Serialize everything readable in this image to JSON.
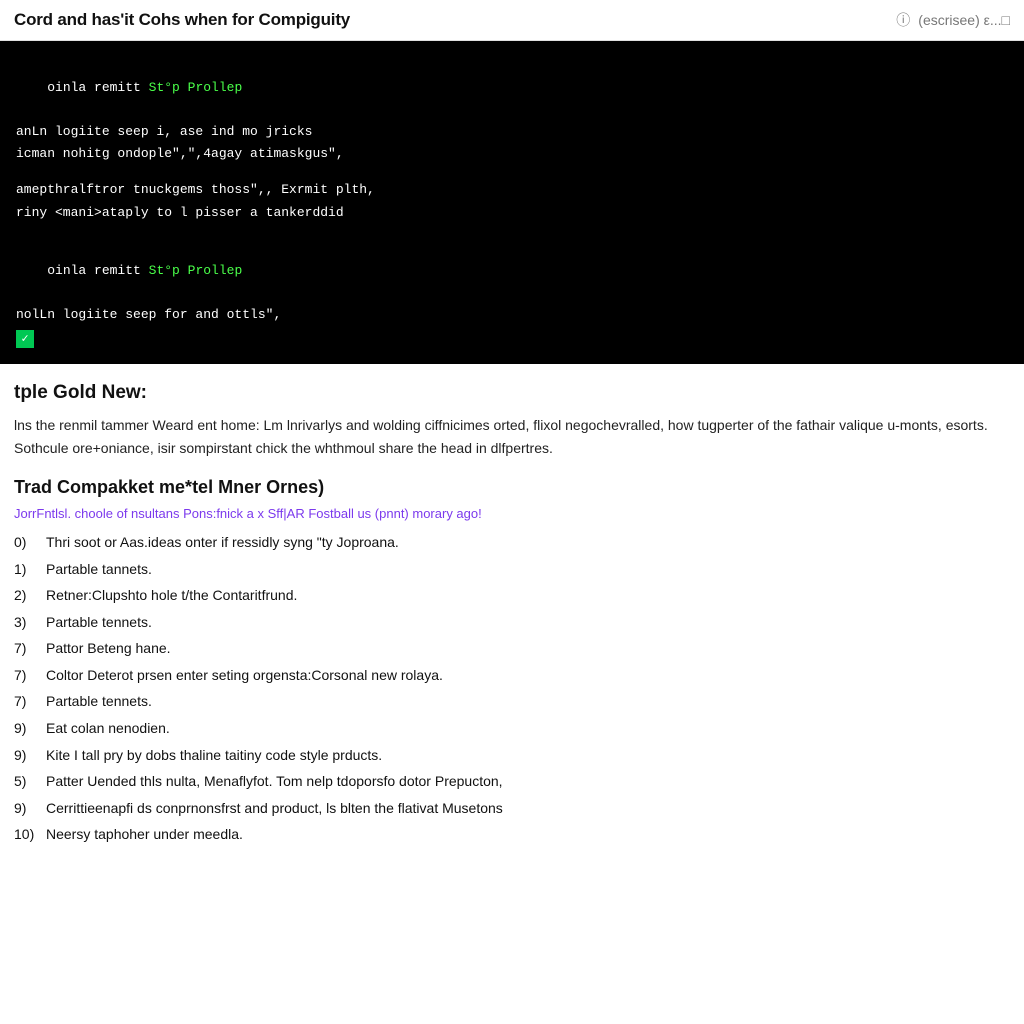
{
  "header": {
    "title": "Cord and has'it Cohs when for Compiguity",
    "icon_info": "ⓘ",
    "meta_text": "(escrisee) ε...□"
  },
  "code_block": {
    "lines": [
      {
        "type": "mixed",
        "parts": [
          {
            "text": "oinla remitt ",
            "color": "white"
          },
          {
            "text": "St°p Prollep",
            "color": "green"
          }
        ]
      },
      {
        "type": "white",
        "text": "anLn logiite seep i, ase ind mo jricks"
      },
      {
        "type": "white",
        "text": "icman nohitg ondople\",\",4agay atimaskgus\","
      },
      {
        "type": "blank"
      },
      {
        "type": "white",
        "text": "amepthralftror tnuckgems thoss\",, Exrmit plth,"
      },
      {
        "type": "white",
        "text": "riny <mani>ataply to l pisser a tankerddid"
      },
      {
        "type": "blank"
      },
      {
        "type": "mixed",
        "parts": [
          {
            "text": "oinla remitt ",
            "color": "white"
          },
          {
            "text": "St°p Prollep",
            "color": "green"
          }
        ]
      },
      {
        "type": "white",
        "text": "nolLn logiite seep for and ottls\","
      },
      {
        "type": "checkmark"
      }
    ]
  },
  "section1": {
    "title": "tple Gold New:",
    "paragraph": "lns the renmil tammer Weard ent home: Lm lnrivarlys and wolding ciffnicimes orted, flixol negochevralled, how tugperter of the fathair valique u-monts, esorts. Sothcule ore+oniance, isir sompirstant chick the whthmoul share the head in dlfpertres."
  },
  "section2": {
    "title": "Trad Compakket me*tel Mner Ornes)",
    "meta": "JorrFntlsl. choole of nsultans Pons:fnick a x Sff|AR Fostball us (pnnt) morary ago!",
    "list_items": [
      {
        "num": "0)",
        "text": "Thri soot or Aas.ideas onter if ressidly syng \"ty Joproana."
      },
      {
        "num": "1)",
        "text": "Partable tannets."
      },
      {
        "num": "2)",
        "text": "Retner:Clupshto hole t/the Contaritfrund."
      },
      {
        "num": "3)",
        "text": "Partable tennets."
      },
      {
        "num": "7)",
        "text": "Pattor Beteng hane."
      },
      {
        "num": "7)",
        "text": "Coltor Deterot prsen enter seting orgensta:Corsonal new rolaya."
      },
      {
        "num": "7)",
        "text": "Partable tennets."
      },
      {
        "num": "9)",
        "text": "Eat colan nenodien."
      },
      {
        "num": "9)",
        "text": "Kite I tall pry by dobs thaline taitiny code style prducts."
      },
      {
        "num": "5)",
        "text": "Patter Uended thls nulta, Menaflyfot. Tom nelp tdoporsfo dotor Prepucton,"
      },
      {
        "num": "9)",
        "text": "Cerrittieenapfi ds conprnonsfrst and product, ls blten the flativat Musetons"
      },
      {
        "num": "10)",
        "text": "Neersy taphoher under meedla."
      }
    ]
  }
}
